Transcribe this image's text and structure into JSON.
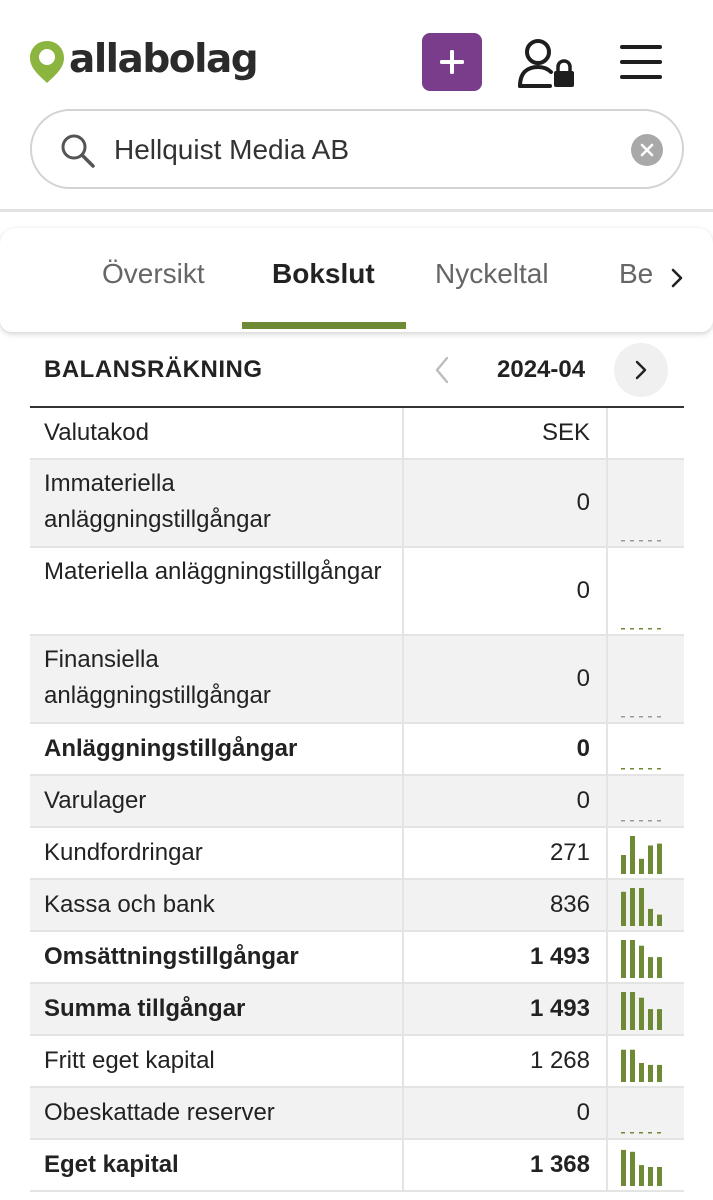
{
  "brand": {
    "name": "allabolag",
    "color": "#8cb53f"
  },
  "header": {
    "add_icon": "plus-icon",
    "user_icon": "user-lock-icon",
    "menu_icon": "hamburger-icon",
    "accent": "#7a3d8c"
  },
  "search": {
    "value": "Hellquist Media AB",
    "icon": "search-icon",
    "clear_icon": "close-icon"
  },
  "tabs": [
    {
      "label": "Översikt",
      "active": false
    },
    {
      "label": "Bokslut",
      "active": true
    },
    {
      "label": "Nyckeltal",
      "active": false
    },
    {
      "label": "Be",
      "active": false
    }
  ],
  "balance": {
    "title": "BALANSRÄKNING",
    "period": "2024-04",
    "rows": [
      {
        "label": "Valutakod",
        "value": "SEK",
        "bold": false,
        "bars": []
      },
      {
        "label": "Immateriella anläggningstillgångar",
        "value": "0",
        "bold": false,
        "bars": [
          0,
          0,
          0,
          0,
          0
        ]
      },
      {
        "label": "Materiella anläggningstillgångar",
        "value": "0",
        "bold": false,
        "bars": [
          0,
          0,
          0,
          0,
          0
        ]
      },
      {
        "label": "Finansiella anläggningstillgångar",
        "value": "0",
        "bold": false,
        "bars": [
          0,
          0,
          0,
          0,
          0
        ]
      },
      {
        "label": "Anläggningstillgångar",
        "value": "0",
        "bold": true,
        "bars": [
          0,
          0,
          0,
          0,
          0
        ]
      },
      {
        "label": "Varulager",
        "value": "0",
        "bold": false,
        "bars": [
          0,
          0,
          0,
          0,
          0
        ]
      },
      {
        "label": "Kundfordringar",
        "value": "271",
        "bold": false,
        "bars": [
          0.5,
          1,
          0.4,
          0.75,
          0.8
        ]
      },
      {
        "label": "Kassa och bank",
        "value": "836",
        "bold": false,
        "bars": [
          0.9,
          1,
          1,
          0.45,
          0.3
        ]
      },
      {
        "label": "Omsättningstillgångar",
        "value": "1 493",
        "bold": true,
        "bars": [
          1,
          1,
          0.85,
          0.55,
          0.55
        ]
      },
      {
        "label": "Summa tillgångar",
        "value": "1 493",
        "bold": true,
        "bars": [
          1,
          1,
          0.85,
          0.55,
          0.55
        ]
      },
      {
        "label": "Fritt eget kapital",
        "value": "1 268",
        "bold": false,
        "bars": [
          0.85,
          0.85,
          0.5,
          0.45,
          0.45
        ]
      },
      {
        "label": "Obeskattade reserver",
        "value": "0",
        "bold": false,
        "bars": [
          0,
          0,
          0,
          0,
          0
        ]
      },
      {
        "label": "Eget kapital",
        "value": "1 368",
        "bold": true,
        "bars": [
          0.95,
          0.9,
          0.55,
          0.5,
          0.5
        ]
      }
    ]
  },
  "colors": {
    "bar": "#6e8a34",
    "tab_underline": "#6e8a34",
    "row_shade": "#f2f2f2"
  }
}
